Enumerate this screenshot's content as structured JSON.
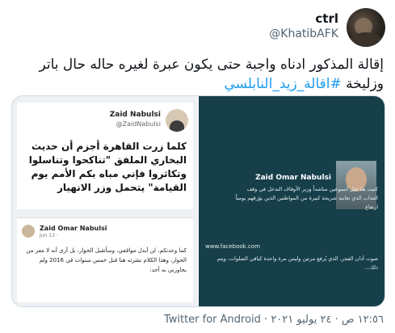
{
  "author": {
    "display_name": "ctrl",
    "handle": "@KhatibAFK"
  },
  "tweet": {
    "text": "إقالة المذكور ادناه واجبة حتى يكون عبرة لغيره حاله حال باتر وزليخة ",
    "hashtag": "#اقالة_زيد_النابلسي"
  },
  "media": {
    "left": {
      "post_name": "Zaid Nabulsi",
      "post_handle": "@ZaidNabulsi",
      "post_text": "كلما زرت القاهرة أجزم أن حديث البخاري الملفق \"تناكحوا وتناسلوا وتكاثروا فإني مباه بكم الأمم يوم القيامة\" يتحمل وزر الانهيار",
      "fb_name": "Zaid Omar Nabulsi",
      "fb_meta": "Jun 13 · ",
      "fb_text": "كما وعدتكم، لن أبدل مواقفي، وسأتقبل الحوار، بل أرى أنه لا مفر من الحوار، وهذا الكلام نشرته هنا قبل خمس سنوات في 2016 ولم يحاورني به أحد:"
    },
    "right": {
      "name": "Zaid Omar Nabulsi",
      "text": "كتبت هنا قبل أسبوعين مناشداً وزير الأوقاف التدخل في وقف العذاب الذي تعانيه شريحة كبيرة من المواطنين الذين يؤرقهم يومياً ارتفاع",
      "site": "www.facebook.com",
      "bottom_text": "صوت أذان الفجر، الذي يُرفع مرتين وليس مرة واحدة كباقي الصلوات، ويتم ذلك..."
    }
  },
  "footer": {
    "time": "١٢:٥٦ ص · ٢٤ يوليو ٢٠٢١ · ",
    "source": "Twitter for Android"
  }
}
